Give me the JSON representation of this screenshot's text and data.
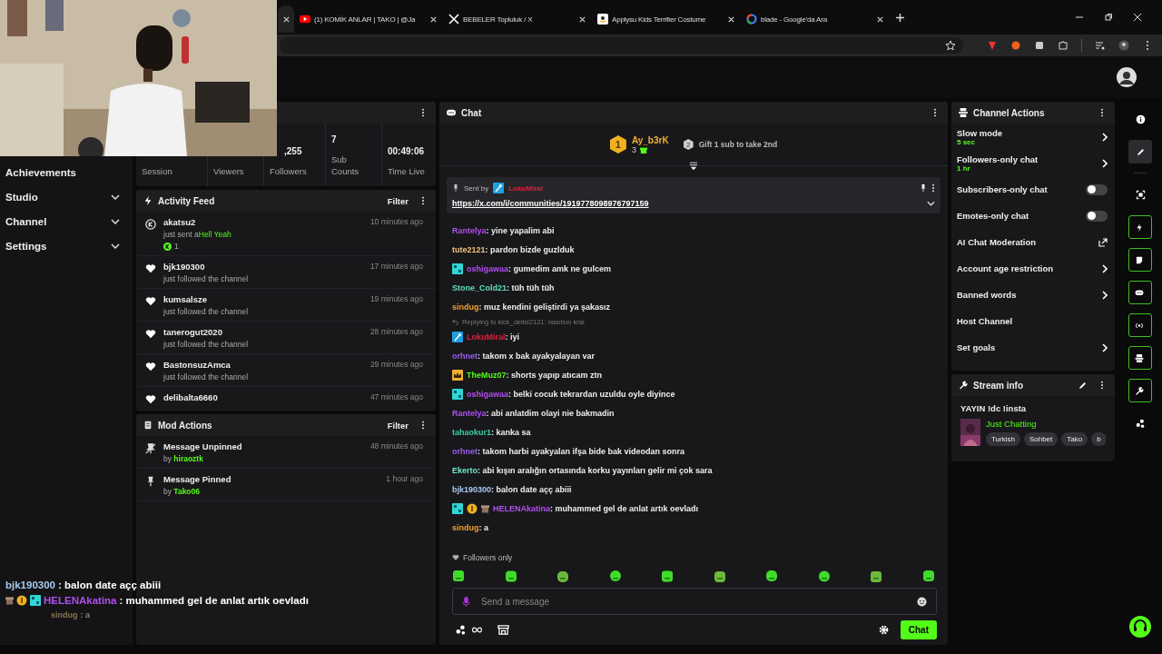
{
  "browser": {
    "tabs": [
      {
        "kind": "partial",
        "selected": true
      },
      {
        "kind": "youtube",
        "title": "(1) KOMİK ANLAR | TAKO | @Ja",
        "selected": false
      },
      {
        "kind": "x",
        "title": "BEBELER Topluluk / X",
        "selected": false
      },
      {
        "kind": "amazon",
        "title": "Applysu Kids Terrifier Costume",
        "selected": false
      },
      {
        "kind": "google",
        "title": "blade - Google'da Ara",
        "selected": false
      }
    ]
  },
  "nav": {
    "items": [
      {
        "label": "Achievements",
        "expandable": false
      },
      {
        "label": "Studio",
        "expandable": true
      },
      {
        "label": "Channel",
        "expandable": true
      },
      {
        "label": "Settings",
        "expandable": true
      }
    ]
  },
  "stats": [
    {
      "label": "Session"
    },
    {
      "label": "Viewers"
    },
    {
      "value": ",255",
      "label": "Followers"
    },
    {
      "value": "7",
      "label": "Sub Counts"
    },
    {
      "value": "00:49:06",
      "label": "Time Live"
    }
  ],
  "activity_feed": {
    "title": "Activity Feed",
    "filter": "Filter",
    "items": [
      {
        "kind": "kicks",
        "user": "akatsu2",
        "action": "just sent a",
        "gift": "Hell Yeah",
        "amount": "1",
        "time": "10 minutes ago"
      },
      {
        "kind": "follow",
        "user": "bjk190300",
        "action": "just followed the channel",
        "time": "17 minutes ago"
      },
      {
        "kind": "follow",
        "user": "kumsalsze",
        "action": "just followed the channel",
        "time": "19 minutes ago"
      },
      {
        "kind": "follow",
        "user": "tanerogut2020",
        "action": "just followed the channel",
        "time": "28 minutes ago"
      },
      {
        "kind": "follow",
        "user": "BastonsuzAmca",
        "action": "just followed the channel",
        "time": "29 minutes ago"
      },
      {
        "kind": "follow",
        "user": "delibalta6660",
        "time": "47 minutes ago"
      }
    ]
  },
  "mod_actions": {
    "title": "Mod Actions",
    "filter": "Filter",
    "items": [
      {
        "kind": "unpin",
        "title": "Message Unpinned",
        "by": "by",
        "moderator": "hiraoztk",
        "time": "48 minutes ago"
      },
      {
        "kind": "pin",
        "title": "Message Pinned",
        "by": "by",
        "moderator": "Tako06",
        "time": "1 hour ago"
      }
    ]
  },
  "chat": {
    "title": "Chat",
    "leaderboard": {
      "rank": "1",
      "user": "Ay_b3rK",
      "count": "3",
      "next_rank": "2",
      "next_text": "Gift 1 sub to take 2nd"
    },
    "pinned": {
      "label": "Sent by",
      "user": "LokuMiral",
      "link": "https://x.com/i/communities/1919778098976797159"
    },
    "messages": [
      {
        "user": "Rantelya",
        "color": "#b24df0",
        "text": ": yine yapalim abi"
      },
      {
        "user": "tute2121",
        "color": "#f0c27a",
        "text": ": pardon bizde guzlduk"
      },
      {
        "user": "oshigawaa",
        "color": "#b24df0",
        "text": ": gumedim amk ne gulcem",
        "badges": [
          {
            "kind": "og"
          }
        ]
      },
      {
        "user": "Stone_Cold21",
        "color": "#5ee0b8",
        "text": ": tüh tüh tüh"
      },
      {
        "user": "sindug",
        "color": "#f0a030",
        "text": ": muz kendini geliştirdi ya şakasız"
      },
      {
        "user": "LokuMiral",
        "color": "#e0203c",
        "text": ": iyi",
        "badges": [
          {
            "kind": "mod"
          }
        ],
        "reply": "Replying to kick_delisi2121: nasılsın kral"
      },
      {
        "user": "orhnet",
        "color": "#9a5cf0",
        "text": ": takom x bak ayakyalayan var"
      },
      {
        "user": "TheMuz07",
        "color": "#53fc18",
        "text": ": shorts yapıp atıcam ztn",
        "badges": [
          {
            "kind": "crown"
          }
        ]
      },
      {
        "user": "oshigawaa",
        "color": "#b24df0",
        "text": ": belki cocuk tekrardan uzuldu oyle diyince",
        "badges": [
          {
            "kind": "og"
          }
        ]
      },
      {
        "user": "Rantelya",
        "color": "#b24df0",
        "text": ": abi anlatdim olayi nie bakmadin"
      },
      {
        "user": "tahaokur1",
        "color": "#3ccfa0",
        "text": ": kanka sa"
      },
      {
        "user": "orhnet",
        "color": "#9a5cf0",
        "text": ": takom harbi ayakyalan ifşa bide bak videodan sonra"
      },
      {
        "user": "Ekerto",
        "color": "#6ee8c8",
        "text": ": abi kışın aralığın ortasında korku yayınları gelir mi çok sara"
      },
      {
        "user": "bjk190300",
        "color": "#a8c8f0",
        "text": ": balon date açç abiii"
      },
      {
        "user": "HELENAkatina",
        "color": "#b24df0",
        "text": ": muhammed gel de anlat artık oevladı",
        "badges": [
          {
            "kind": "og"
          },
          {
            "kind": "coin"
          },
          {
            "kind": "gift"
          }
        ]
      },
      {
        "user": "sindug",
        "color": "#f0a030",
        "text": ": a"
      }
    ],
    "mode": "Followers only",
    "emotes": [
      {
        "kind": "emote"
      },
      {
        "kind": "emote"
      },
      {
        "kind": "emote"
      },
      {
        "kind": "emote"
      },
      {
        "kind": "emote"
      },
      {
        "kind": "emote"
      },
      {
        "kind": "emote"
      },
      {
        "kind": "emote"
      },
      {
        "kind": "emote"
      },
      {
        "kind": "emote"
      }
    ],
    "input": {
      "placeholder": "Send a message"
    },
    "send": "Chat"
  },
  "channel_actions": {
    "title": "Channel Actions",
    "items": [
      {
        "kind": "arrow",
        "label": "Slow mode",
        "value": "5 sec"
      },
      {
        "kind": "arrow",
        "label": "Followers-only chat",
        "value": "1 hr"
      },
      {
        "kind": "toggle",
        "label": "Subscribers-only chat",
        "on": false
      },
      {
        "kind": "toggle",
        "label": "Emotes-only chat",
        "on": false
      },
      {
        "kind": "external",
        "label": "AI Chat Moderation"
      },
      {
        "kind": "arrow",
        "label": "Account age restriction"
      },
      {
        "kind": "arrow",
        "label": "Banned words"
      },
      {
        "kind": "plain",
        "label": "Host Channel"
      },
      {
        "kind": "arrow",
        "label": "Set goals"
      }
    ]
  },
  "stream_info": {
    "title": "Stream info",
    "stream_title": "YAYIN !dc !insta",
    "category": "Just Chatting",
    "tags": [
      "Turkish",
      "Sohbet",
      "Tako",
      "b"
    ]
  },
  "rail": [
    {
      "kind": "info",
      "selected": false,
      "active": false
    },
    {
      "kind": "pencil",
      "selected": true,
      "active": false
    },
    {
      "kind": "scan",
      "selected": false,
      "active": false
    },
    {
      "kind": "bolt",
      "selected": false,
      "active": true
    },
    {
      "kind": "note",
      "selected": false,
      "active": true
    },
    {
      "kind": "chat",
      "selected": false,
      "active": true
    },
    {
      "kind": "broadcast",
      "selected": false,
      "active": true
    },
    {
      "kind": "layout",
      "selected": false,
      "active": true
    },
    {
      "kind": "wrench",
      "selected": false,
      "active": true
    },
    {
      "kind": "gems",
      "selected": false,
      "active": false
    }
  ],
  "overlay": {
    "lines": [
      {
        "user": "bjk190300",
        "color": "#a8c8f0",
        "text": ": balon date açç abiii",
        "faded": false
      },
      {
        "user": "HELENAkatina",
        "color": "#b24df0",
        "text": ": muhammed gel de anlat artık oevladı",
        "badges": [
          {
            "kind": "gift"
          },
          {
            "kind": "coin"
          },
          {
            "kind": "og"
          }
        ],
        "faded": false
      },
      {
        "user": "sindug",
        "color": "#8a7450",
        "text": ": a",
        "faded": true
      }
    ]
  }
}
